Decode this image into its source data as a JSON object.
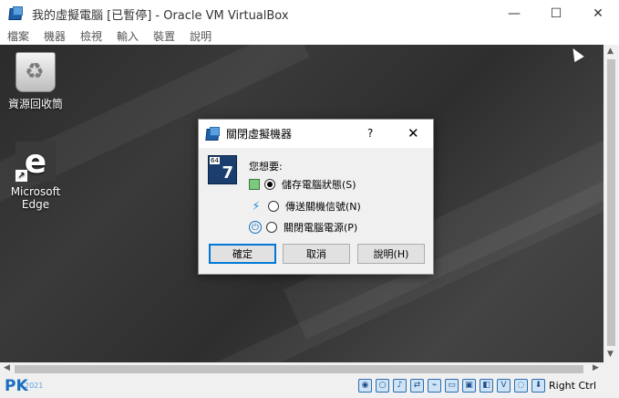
{
  "window": {
    "title": "我的虛擬電腦 [已暫停] - Oracle VM VirtualBox",
    "controls": {
      "minimize": "—",
      "maximize": "☐",
      "close": "✕"
    }
  },
  "menu": [
    "檔案",
    "機器",
    "檢視",
    "輸入",
    "裝置",
    "說明"
  ],
  "desktop": {
    "icons": [
      {
        "label": "資源回收筒",
        "icon": "recycle-bin-icon"
      },
      {
        "label": "Microsoft Edge",
        "icon": "edge-icon",
        "glyph": "e",
        "shortcut": "↗"
      }
    ]
  },
  "dialog": {
    "title": "關閉虛擬機器",
    "help": "?",
    "close": "✕",
    "vm_badge": "64",
    "vm_number": "7",
    "prompt": "您想要:",
    "options": [
      {
        "label": "儲存電腦狀態(S)",
        "icon": "save-state-icon",
        "selected": true,
        "glyph": ""
      },
      {
        "label": "傳送關機信號(N)",
        "icon": "acpi-bolt-icon",
        "selected": false,
        "glyph": "⚡"
      },
      {
        "label": "關閉電腦電源(P)",
        "icon": "power-icon",
        "selected": false,
        "glyph": "⏻"
      }
    ],
    "buttons": {
      "ok": "確定",
      "cancel": "取消",
      "help": "說明(H)"
    }
  },
  "scroll": {
    "up": "▲",
    "down": "▼",
    "left": "◀",
    "right": "▶"
  },
  "statusbar": {
    "watermark": "PK",
    "watermark_sub": "2021",
    "device_icons": [
      "hdd-icon",
      "optical-icon",
      "audio-icon",
      "network-icon",
      "usb-icon",
      "shared-folder-icon",
      "display-icon",
      "video-capture-icon",
      "vt-icon",
      "mouse-integration-icon",
      "keyboard-icon"
    ],
    "device_glyphs": [
      "◉",
      "○",
      "♪",
      "⇄",
      "⌁",
      "▭",
      "▣",
      "◧",
      "V",
      "◌",
      "⬇"
    ],
    "host_key": "Right Ctrl"
  },
  "colors": {
    "accent": "#0078d7",
    "desktop": "#333333",
    "vbox_blue": "#1a6fc0"
  }
}
